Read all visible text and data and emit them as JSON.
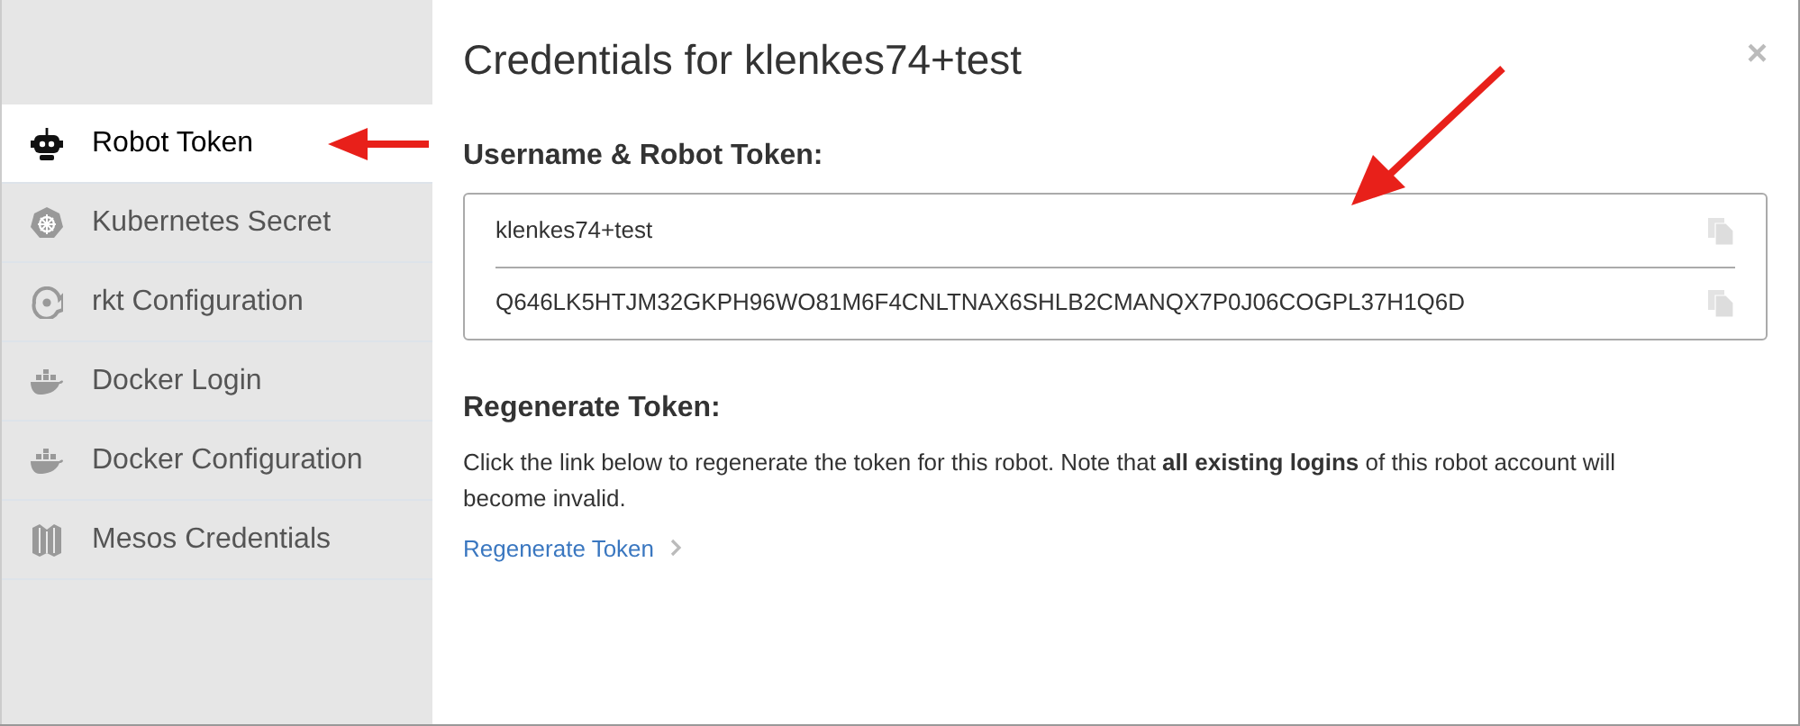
{
  "sidebar": {
    "items": [
      {
        "label": "Robot Token",
        "selected": true
      },
      {
        "label": "Kubernetes Secret",
        "selected": false
      },
      {
        "label": "rkt Configuration",
        "selected": false
      },
      {
        "label": "Docker Login",
        "selected": false
      },
      {
        "label": "Docker Configuration",
        "selected": false
      },
      {
        "label": "Mesos Credentials",
        "selected": false
      }
    ]
  },
  "dialog": {
    "title": "Credentials for klenkes74+test",
    "close": "×",
    "credentials_heading": "Username & Robot Token:",
    "credentials": [
      "klenkes74+test",
      "Q646LK5HTJM32GKPH96WO81M6F4CNLTNAX6SHLB2CMANQX7P0J06COGPL37H1Q6D"
    ],
    "regenerate_heading": "Regenerate Token:",
    "regenerate_text": "Click the link below to regenerate the token for this robot. Note that **all existing logins** of this robot account will become invalid.",
    "regenerate_link": "Regenerate Token"
  }
}
